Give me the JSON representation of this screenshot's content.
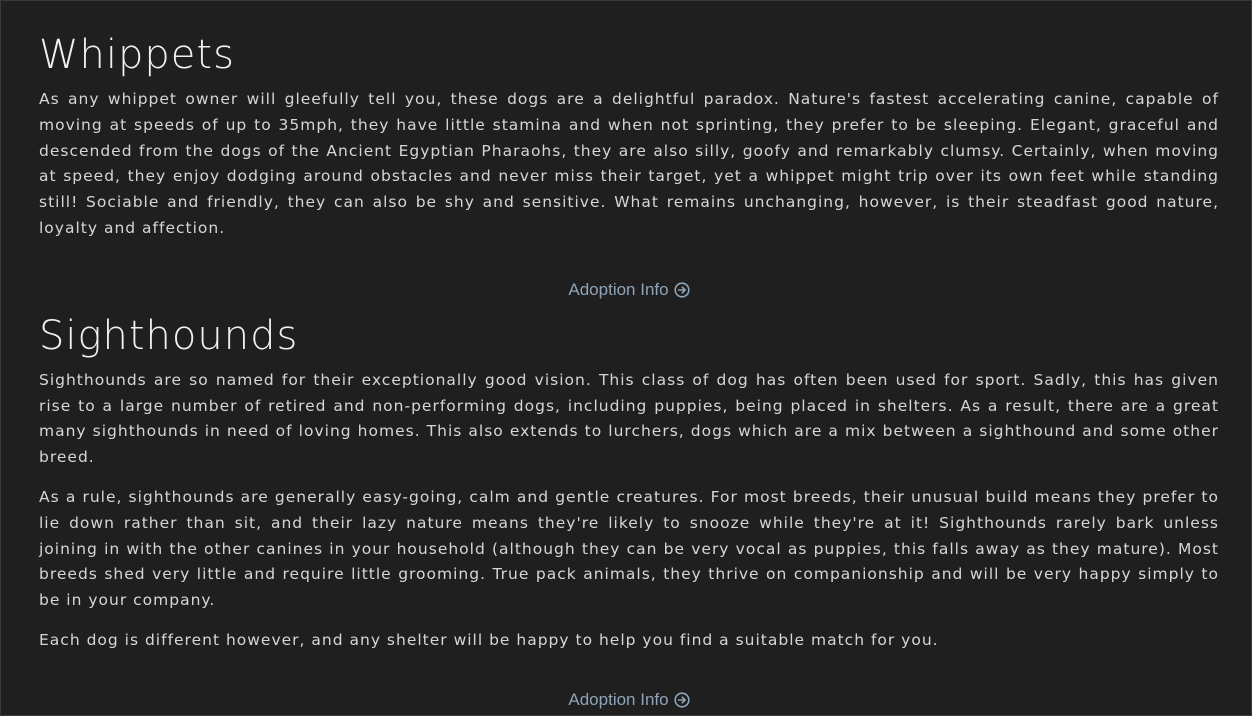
{
  "sections": [
    {
      "heading": "Whippets",
      "paragraphs": [
        "As any whippet owner will gleefully tell you, these dogs are a delightful paradox. Nature's fastest accelerating canine, capable of moving at speeds of up to 35mph, they have little stamina and when not sprinting, they prefer to be sleeping. Elegant, graceful and descended from the dogs of the Ancient Egyptian Pharaohs, they are also silly, goofy and remarkably clumsy. Certainly, when moving at speed, they enjoy dodging around obstacles and never miss their target, yet a whippet might trip over its own feet while standing still! Sociable and friendly, they can also be shy and sensitive. What remains unchanging, however, is their steadfast good nature, loyalty and affection."
      ],
      "link_label": "Adoption Info",
      "link_icon": "arrow-circle-right-icon"
    },
    {
      "heading": "Sighthounds",
      "paragraphs": [
        "Sighthounds are so named for their exceptionally good vision. This class of dog has often been used for sport. Sadly, this has given rise to a large number of retired and non-performing dogs, including puppies, being placed in shelters. As a result, there are a great many sighthounds in need of loving homes. This also extends to lurchers, dogs which are a mix between a sighthound and some other breed.",
        "As a rule, sighthounds are generally easy-going, calm and gentle creatures. For most breeds, their unusual build means they prefer to lie down rather than sit, and their lazy nature means they're likely to snooze while they're at it! Sighthounds rarely bark unless joining in with the other canines in your household (although they can be very vocal as puppies, this falls away as they mature). Most breeds shed very little and require little grooming. True pack animals, they thrive on companionship and will be very happy simply to be in your company.",
        "Each dog is different however, and any shelter will be happy to help you find a suitable match for you."
      ],
      "link_label": "Adoption Info",
      "link_icon": "arrow-circle-right-icon"
    }
  ],
  "colors": {
    "background": "#1f1f1f",
    "text": "#d6d6d6",
    "heading": "#f0f0f0",
    "link": "#8ea4b8"
  }
}
